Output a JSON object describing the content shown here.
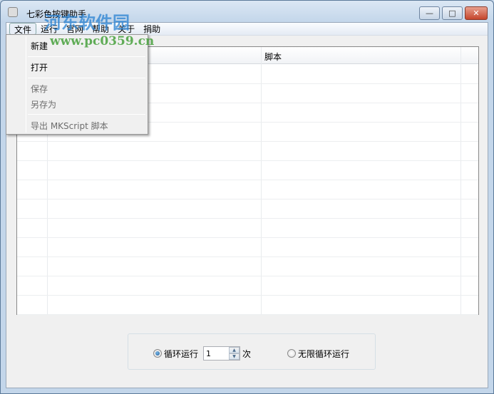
{
  "window": {
    "title": "七彩色按键助手",
    "minimize": "—",
    "maximize": "□",
    "close": "✕"
  },
  "menubar": [
    "文件",
    "运行",
    "官网",
    "帮助",
    "关于",
    "捐助"
  ],
  "file_menu": {
    "new": "新建",
    "open": "打开",
    "save": "保存",
    "save_as": "另存为",
    "export": "导出 MKScript 脚本"
  },
  "table": {
    "columns": [
      "脚本"
    ],
    "rows": []
  },
  "loop": {
    "loop_label": "循环运行",
    "count": "1",
    "times_label": "次",
    "infinite_label": "无限循环运行",
    "selected": "loop"
  },
  "watermark": {
    "name": "河东软件园",
    "url": "www.pc0359.cn"
  }
}
